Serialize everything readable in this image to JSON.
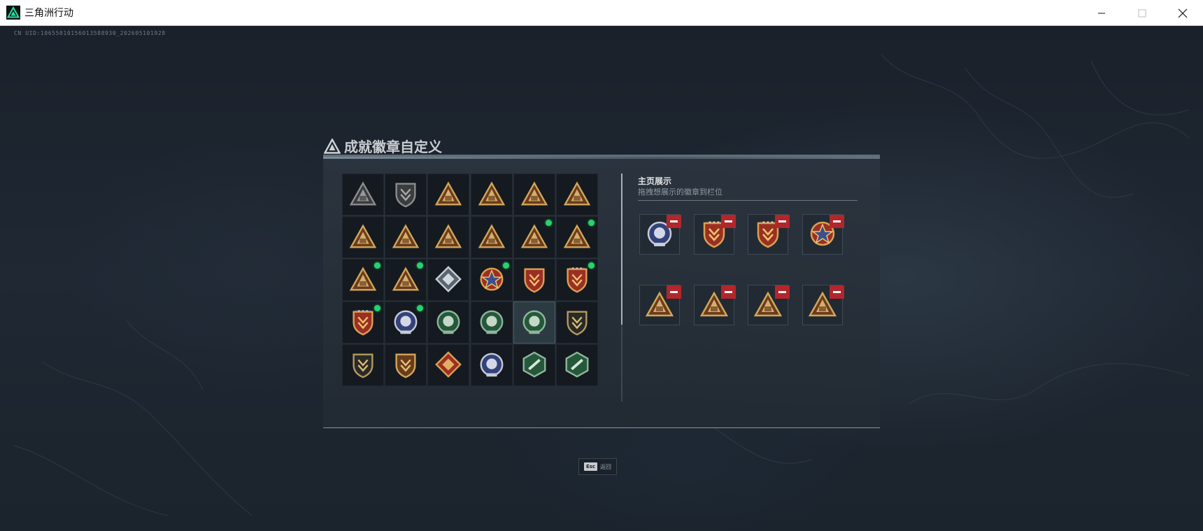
{
  "window": {
    "title": "三角洲行动",
    "logo_icon": "delta-force-logo-icon",
    "controls": [
      "minimize-icon",
      "maximize-icon",
      "close-icon"
    ]
  },
  "overlay": {
    "uid": "CN UID:10655010156013588930_202605101928"
  },
  "panel": {
    "title": "成就徽章自定义",
    "title_icon": "delta-force-logo-icon",
    "badge_grid": {
      "rows": [
        [
          {
            "icon": "shield-triangle-badge-icon",
            "new": false,
            "tier": "gray"
          },
          {
            "icon": "helicopter-badge-icon",
            "new": false,
            "tier": "gray"
          },
          {
            "icon": "vehicle-triangle-badge-icon",
            "new": false,
            "tier": "gold"
          },
          {
            "icon": "radio-triangle-badge-icon",
            "new": false,
            "tier": "gold"
          },
          {
            "icon": "number-56-triangle-badge-icon",
            "new": false,
            "tier": "gold"
          },
          {
            "icon": "crate-triangle-badge-icon",
            "new": false,
            "tier": "gold"
          }
        ],
        [
          {
            "icon": "armor-triangle-badge-icon",
            "new": false,
            "tier": "gold"
          },
          {
            "icon": "drone-triangle-badge-icon",
            "new": false,
            "tier": "gold"
          },
          {
            "icon": "helmet-triangle-badge-icon",
            "new": false,
            "tier": "gold"
          },
          {
            "icon": "number-1-triangle-badge-icon",
            "new": false,
            "tier": "gold"
          },
          {
            "icon": "barrel-triangle-badge-icon",
            "new": true,
            "tier": "gold"
          },
          {
            "icon": "soldier-triangle-badge-icon",
            "new": true,
            "tier": "gold"
          }
        ],
        [
          {
            "icon": "squad-triangle-badge-icon",
            "new": true,
            "tier": "gold"
          },
          {
            "icon": "missile-triangle-badge-icon",
            "new": true,
            "tier": "gold"
          },
          {
            "icon": "diamond-crest-badge-icon",
            "new": false,
            "tier": "silver"
          },
          {
            "icon": "star-cross-badge-icon",
            "new": true,
            "tier": "red"
          },
          {
            "icon": "chevron-shield-badge-icon",
            "new": false,
            "tier": "red"
          },
          {
            "icon": "starred-shield-badge-icon",
            "new": true,
            "tier": "red"
          }
        ],
        [
          {
            "icon": "crested-shield-badge-icon",
            "new": true,
            "tier": "red"
          },
          {
            "icon": "astronaut-helmet-badge-icon",
            "new": true,
            "tier": "blue"
          },
          {
            "icon": "skull-emblem-badge-icon",
            "new": false,
            "tier": "green"
          },
          {
            "icon": "eye-emblem-badge-icon",
            "new": false,
            "tier": "green"
          },
          {
            "icon": "crosshair-emblem-badge-icon",
            "new": false,
            "tier": "green"
          },
          {
            "icon": "rifle-crest-badge-icon",
            "new": false,
            "tier": "dark"
          }
        ],
        [
          {
            "icon": "eagle-shield-badge-icon",
            "new": false,
            "tier": "dark"
          },
          {
            "icon": "wings-shield-badge-icon",
            "new": false,
            "tier": "gold"
          },
          {
            "icon": "beast-diamond-badge-icon",
            "new": false,
            "tier": "red"
          },
          {
            "icon": "wolf-circle-badge-icon",
            "new": false,
            "tier": "blue"
          },
          {
            "icon": "soldier-hex-badge-icon",
            "new": false,
            "tier": "green"
          },
          {
            "icon": "gun-hex-badge-icon",
            "new": false,
            "tier": "green"
          }
        ]
      ],
      "selected_cell": [
        3,
        4
      ]
    },
    "showcase": {
      "title": "主页展示",
      "subtitle": "拖拽想展示的徽章到栏位",
      "slots": [
        {
          "icon": "astronaut-helmet-badge-icon",
          "tier": "blue"
        },
        {
          "icon": "crested-shield-badge-icon",
          "tier": "red"
        },
        {
          "icon": "starred-shield-badge-icon",
          "tier": "red"
        },
        {
          "icon": "star-cross-badge-icon",
          "tier": "red"
        },
        {
          "icon": "missile-triangle-badge-icon",
          "tier": "gold"
        },
        {
          "icon": "barrel-triangle-badge-icon",
          "tier": "gold"
        },
        {
          "icon": "soldier-triangle-badge-icon",
          "tier": "gold"
        },
        {
          "icon": "squad-triangle-badge-icon",
          "tier": "gold"
        }
      ],
      "remove_icon": "minus-icon"
    }
  },
  "footer": {
    "esc_key": "Esc",
    "esc_label": "返回"
  },
  "colors": {
    "new_indicator": "#24d46a",
    "remove_button": "#b3262b",
    "gold": "#c9a04f",
    "red": "#a83a2e",
    "blue": "#3b4f8c",
    "green": "#2f6b45"
  }
}
